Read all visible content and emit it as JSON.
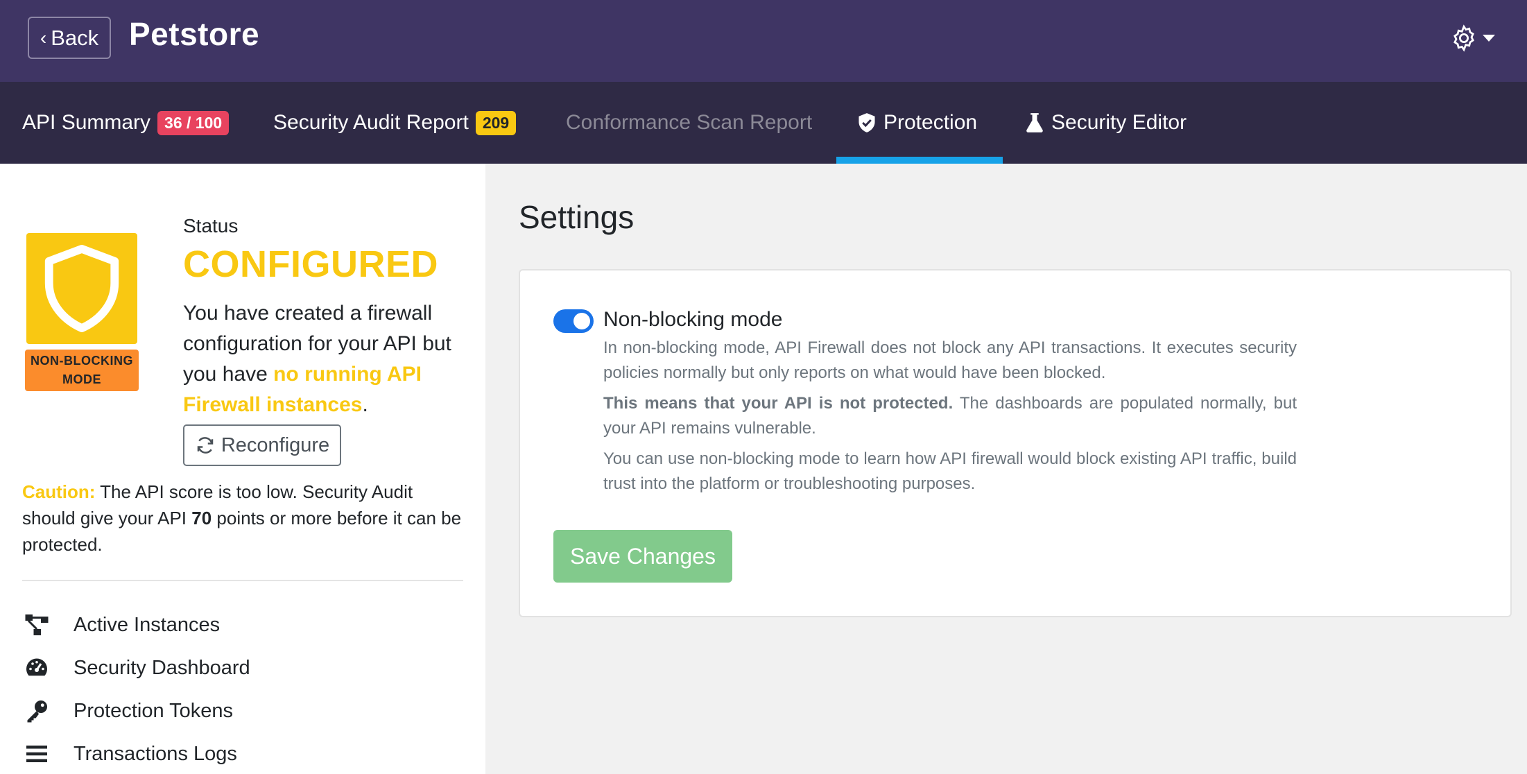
{
  "header": {
    "back_label": "Back",
    "app_title": "Petstore",
    "settings_icon": "gear-icon"
  },
  "tabs": [
    {
      "label": "API Summary",
      "badge": "36 / 100",
      "badge_color": "#e8435f",
      "state": "default"
    },
    {
      "label": "Security Audit Report",
      "badge": "209",
      "badge_color": "#f9c812",
      "state": "default"
    },
    {
      "label": "Conformance Scan Report",
      "state": "disabled"
    },
    {
      "label": "Protection",
      "icon": "shield-check-icon",
      "state": "active"
    },
    {
      "label": "Security Editor",
      "icon": "flask-icon",
      "state": "default"
    }
  ],
  "status": {
    "label": "Status",
    "value": "CONFIGURED",
    "mode_badge": "NON-BLOCKING MODE",
    "desc_prefix": "You have created a firewall configuration for your API but you have ",
    "desc_highlight": "no running API Firewall instances",
    "desc_suffix": ".",
    "reconfigure_label": "Reconfigure"
  },
  "caution": {
    "label": "Caution:",
    "text_a": " The API score is too low. Security Audit should give your API ",
    "score": "70",
    "text_b": " points or more before it can be protected."
  },
  "nav": [
    {
      "label": "Active Instances",
      "icon": "network-icon"
    },
    {
      "label": "Security Dashboard",
      "icon": "gauge-icon"
    },
    {
      "label": "Protection Tokens",
      "icon": "key-icon"
    },
    {
      "label": "Transactions Logs",
      "icon": "list-icon"
    }
  ],
  "settings": {
    "title": "Settings",
    "option_label": "Non-blocking mode",
    "option_enabled": true,
    "para1": "In non-blocking mode, API Firewall does not block any API transactions. It executes security policies normally but only reports on what would have been blocked.",
    "para2_bold": "This means that your API is not protected.",
    "para2_rest": " The dashboards are populated normally, but your API remains vulnerable.",
    "para3": "You can use non-blocking mode to learn how API firewall would block existing API traffic, build trust into the platform or troubleshooting purposes.",
    "save_label": "Save Changes"
  },
  "colors": {
    "header_bg": "#3f3564",
    "tabbar_bg": "#2f2a45",
    "accent_yellow": "#f9c812",
    "accent_orange": "#fb8c2c",
    "active_tab_underline": "#17a2e8",
    "toggle_on": "#1a73e8",
    "save_button": "#82ca8c"
  }
}
